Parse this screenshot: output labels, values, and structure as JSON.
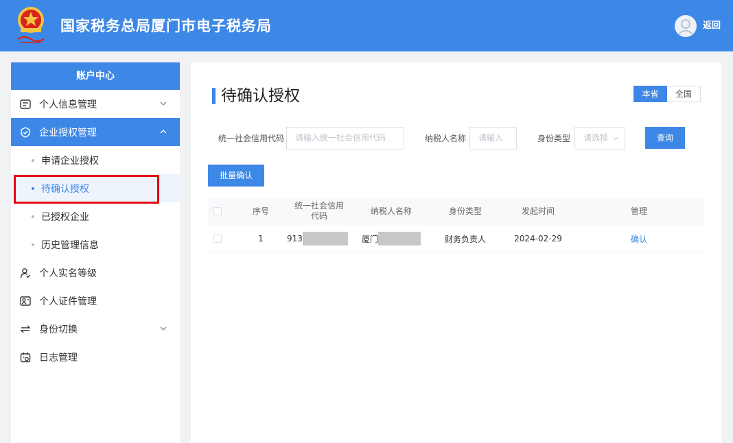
{
  "header": {
    "title": "国家税务总局厦门市电子税务局",
    "back_label": "返回"
  },
  "sidebar": {
    "title": "账户中心",
    "items": [
      {
        "label": "个人信息管理",
        "icon": "id-card-icon",
        "expandable": true,
        "expanded": false
      },
      {
        "label": "企业授权管理",
        "icon": "shield-check-icon",
        "expandable": true,
        "expanded": true,
        "active": true,
        "children": [
          {
            "label": "申请企业授权"
          },
          {
            "label": "待确认授权",
            "active": true
          },
          {
            "label": "已授权企业"
          },
          {
            "label": "历史管理信息"
          }
        ]
      },
      {
        "label": "个人实名等级",
        "icon": "user-verify-icon",
        "expandable": false
      },
      {
        "label": "个人证件管理",
        "icon": "certificate-icon",
        "expandable": false
      },
      {
        "label": "身份切换",
        "icon": "switch-icon",
        "expandable": true,
        "expanded": false
      },
      {
        "label": "日志管理",
        "icon": "calendar-log-icon",
        "expandable": false
      }
    ]
  },
  "main": {
    "title": "待确认授权",
    "region_toggle": {
      "options": [
        "本省",
        "全国"
      ],
      "selected": "本省"
    },
    "filters": {
      "credit_code": {
        "label": "统一社会信用代码",
        "placeholder": "请输入统一社会信用代码",
        "value": ""
      },
      "taxpayer_name": {
        "label": "纳税人名称",
        "placeholder": "请输入",
        "value": ""
      },
      "identity_type": {
        "label": "身份类型",
        "placeholder": "请选择",
        "value": ""
      }
    },
    "search_button": "查询",
    "batch_confirm_button": "批量确认",
    "table": {
      "columns": [
        "序号",
        "统一社会信用代码",
        "纳税人名称",
        "身份类型",
        "发起时间",
        "管理"
      ],
      "rows": [
        {
          "index": "1",
          "credit_code": "913",
          "taxpayer_name": "厦门",
          "identity_type": "财务负责人",
          "initiated": "2024-02-29",
          "action": "确认"
        }
      ]
    }
  },
  "colors": {
    "primary": "#3d87e6",
    "highlight_box": "#e60012"
  }
}
